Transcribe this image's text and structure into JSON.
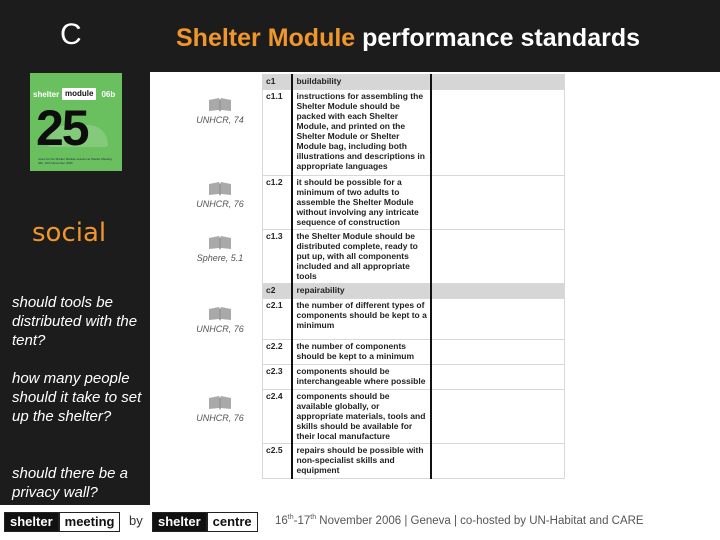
{
  "header": {
    "section_letter": "C",
    "title_accent": "Shelter Module",
    "title_rest": " performance standards"
  },
  "cover": {
    "bar_word1": "shelter",
    "bar_word2": "module",
    "bar_code": "06b",
    "number": "25",
    "caption": "notes for the Shelter Module session at Shelter Meeting 06b, 16th November 2006"
  },
  "sidebar": {
    "category": "social",
    "questions": [
      "should tools be distributed with the tent?",
      "how many people should it take to set up the shelter?",
      "should there be a privacy wall?"
    ]
  },
  "references": [
    {
      "icon": "book-icon",
      "label": "UNHCR, 74"
    },
    {
      "icon": "book-icon",
      "label": "UNHCR, 76"
    },
    {
      "icon": "book-icon",
      "label": "Sphere, 5.1"
    },
    {
      "icon": "book-icon",
      "label": "UNHCR, 76"
    },
    {
      "icon": "book-icon",
      "label": "UNHCR, 76"
    }
  ],
  "standards_table": {
    "rows": [
      {
        "type": "head",
        "code": "c1",
        "text": "buildability"
      },
      {
        "type": "item",
        "code": "c1.1",
        "text": "instructions for assembling the Shelter Module should be packed with each Shelter Module, and printed on the Shelter Module or Shelter Module bag, including both illustrations and descriptions in appropriate languages"
      },
      {
        "type": "item",
        "code": "c1.2",
        "text": "it should be possible for a minimum of two adults to assemble the Shelter Module without involving any intricate sequence of construction"
      },
      {
        "type": "item",
        "code": "c1.3",
        "text": "the Shelter Module should be distributed complete, ready to put up, with all components included and all appropriate tools"
      },
      {
        "type": "head",
        "code": "c2",
        "text": "repairability"
      },
      {
        "type": "item",
        "code": "c2.1",
        "text": "the number of different types of components should be kept to a minimum"
      },
      {
        "type": "item",
        "code": "c2.2",
        "text": "the number of components should be kept to a minimum"
      },
      {
        "type": "item",
        "code": "c2.3",
        "text": "components should be interchangeable where possible"
      },
      {
        "type": "item",
        "code": "c2.4",
        "text": "components should be available globally,  or appropriate materials, tools and skills should be available for their local manufacture"
      },
      {
        "type": "item",
        "code": "c2.5",
        "text": "repairs should be possible with non-specialist skills and equipment"
      }
    ]
  },
  "footer": {
    "brand1_dark": "shelter",
    "brand1_light": "meeting",
    "by": "by",
    "brand2_dark": "shelter",
    "brand2_light": "centre",
    "day1": "16",
    "day1_suffix": "th",
    "day2": "-17",
    "day2_suffix": "th",
    "date_rest": " November  2006  |  Geneva   |  co-hosted by UN-Habitat and CARE"
  },
  "colors": {
    "accent": "#f0962a",
    "background_dark": "#1c1c1c",
    "cover_green": "#6abf5e",
    "table_header": "#d6d6d6"
  }
}
